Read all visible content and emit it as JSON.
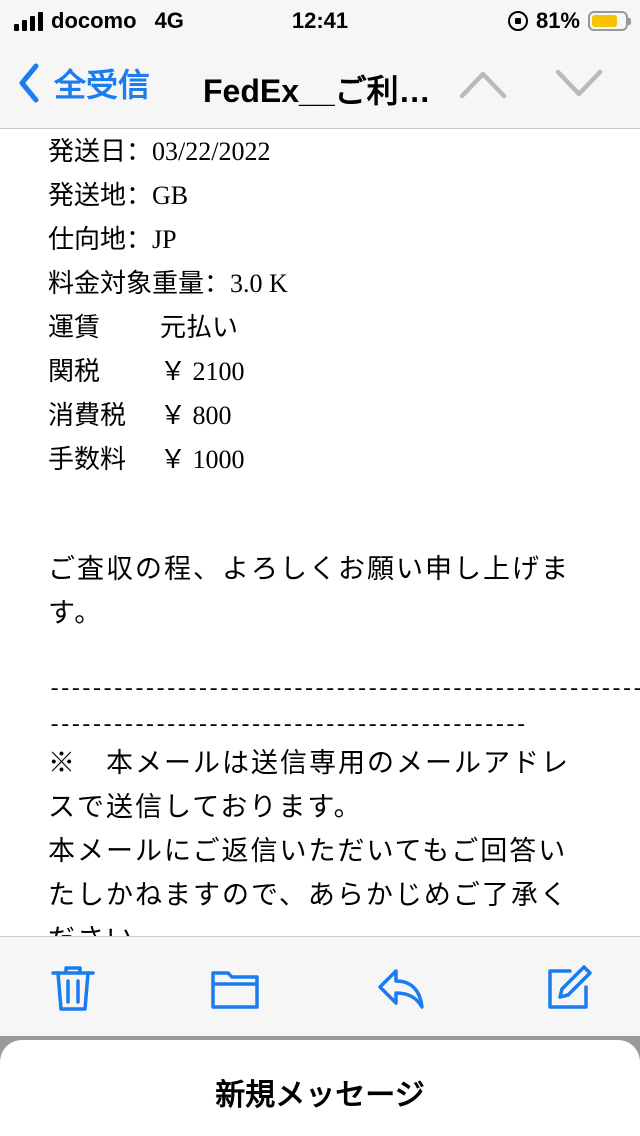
{
  "status_bar": {
    "carrier": "docomo",
    "network": "4G",
    "time": "12:41",
    "battery": "81%",
    "battery_level": 0.81,
    "battery_color": "#f5c400"
  },
  "nav": {
    "back_label": "全受信",
    "title": "FedEx__ご利…",
    "accent_color": "#1a7cf0",
    "icons": [
      "chevron-left-icon",
      "chevron-up-icon",
      "chevron-down-icon"
    ]
  },
  "mail": {
    "fields": [
      {
        "label": "発送日：",
        "value": "03/22/2022"
      },
      {
        "label": "発送地：",
        "value": "GB"
      },
      {
        "label": "仕向地：",
        "value": "JP"
      },
      {
        "label": "料金対象重量：",
        "value": "3.0 K"
      }
    ],
    "charges": [
      {
        "label": "運賃",
        "value": "元払い"
      },
      {
        "label": "関税",
        "value": "￥ 2100"
      },
      {
        "label": "消費税",
        "value": "￥ 800"
      },
      {
        "label": "手数料",
        "value": "￥ 1000"
      }
    ],
    "closing": "ご査収の程、よろしくお願い申し上げます。",
    "divider_line1": "------------------------------------------------------------",
    "divider_line2": "---------------------------------------------",
    "notice1": "※　本メールは送信専用のメールアドレスで送信しております。",
    "notice2": "本メールにご返信いただいてもご回答いたしかねますので、あらかじめご了承くださ",
    "notice2_cut": "い。"
  },
  "toolbar": {
    "icons": [
      "trash-icon",
      "folder-icon",
      "reply-icon",
      "compose-icon"
    ]
  },
  "draft": {
    "label": "新規メッセージ"
  }
}
